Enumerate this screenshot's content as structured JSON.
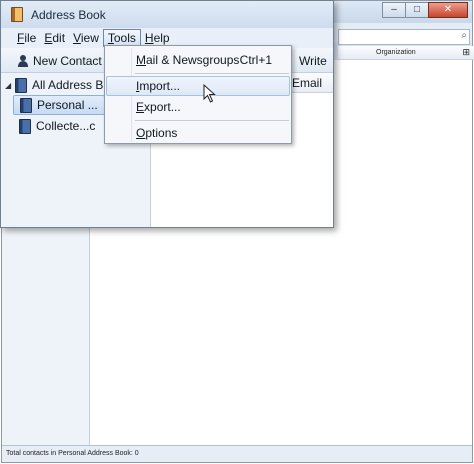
{
  "bg_window": {
    "caption_buttons": {
      "minimize": "–",
      "maximize": "□",
      "close": "✕"
    },
    "column_organization": "Organization",
    "status_text": "Total contacts in Personal Address Book: 0"
  },
  "window": {
    "title": "Address Book",
    "icon": "address-book-icon"
  },
  "menubar": {
    "items": [
      {
        "label": "File",
        "mnemonic": "F",
        "rest": "ile"
      },
      {
        "label": "Edit",
        "mnemonic": "E",
        "rest": "dit"
      },
      {
        "label": "View",
        "mnemonic": "V",
        "rest": "iew"
      },
      {
        "label": "Tools",
        "mnemonic": "T",
        "rest": "ools"
      },
      {
        "label": "Help",
        "mnemonic": "H",
        "rest": "elp"
      }
    ]
  },
  "toolbar": {
    "new_contact_label": "New Contact",
    "write_label": "Write"
  },
  "tree": {
    "items": [
      {
        "label": "All Address B",
        "expanded": true
      },
      {
        "label": "Personal ...",
        "selected": true
      },
      {
        "label": "Collecte...c"
      }
    ]
  },
  "columns": {
    "email": "Email"
  },
  "tools_menu": {
    "item0": {
      "mn": "M",
      "rest": "ail & Newsgroups",
      "shortcut": "Ctrl+1"
    },
    "item1": {
      "mn": "I",
      "rest": "mport..."
    },
    "item2": {
      "mn": "E",
      "rest": "xport..."
    },
    "item3": {
      "mn": "O",
      "rest": "ptions"
    }
  },
  "colors": {
    "title_bar": "#cddcee",
    "menu_highlight": "#dde8f6",
    "selection": "#c7dbf4"
  }
}
